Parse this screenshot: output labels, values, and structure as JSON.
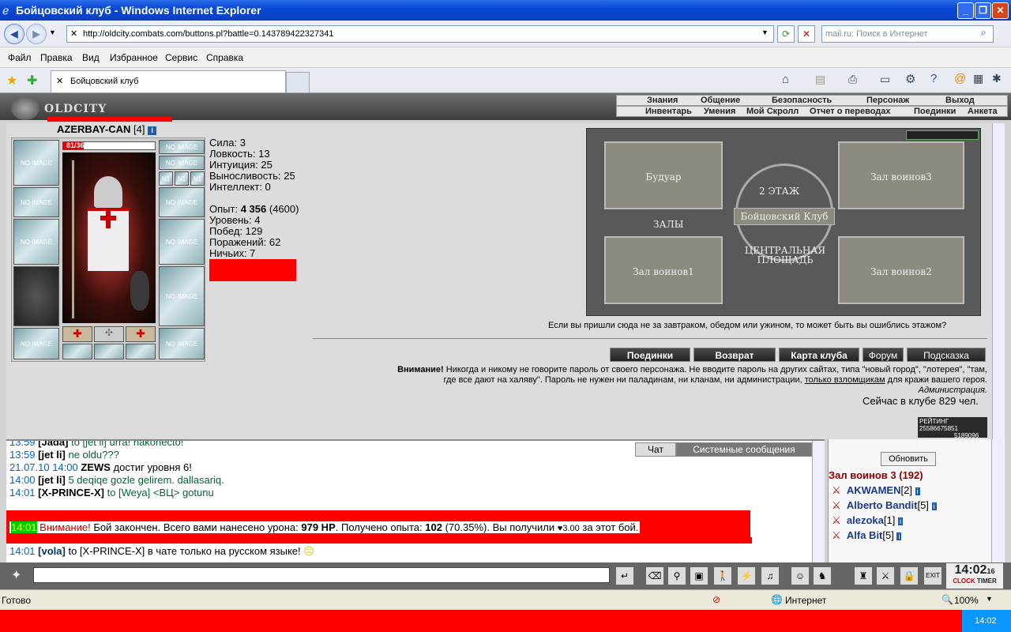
{
  "window": {
    "title": "Бойцовский клуб - Windows Internet Explorer"
  },
  "address": {
    "url": "http://oldcity.combats.com/buttons.pl?battle=0.143789422327341",
    "search_placeholder": "mail.ru: Поиск в Интернет"
  },
  "menu": [
    "Файл",
    "Правка",
    "Вид",
    "Избранное",
    "Сервис",
    "Справка"
  ],
  "tab": {
    "title": "Бойцовский клуб"
  },
  "game": {
    "logo": "OLDCITY",
    "menu_top": [
      "Знания",
      "Общение",
      "Безопасность",
      "Персонаж",
      "Выход"
    ],
    "menu_bottom": [
      "Инвентарь",
      "Умения",
      "Мой Скролл",
      "Отчет о переводах",
      "Поединки",
      "Анкета"
    ],
    "character": {
      "name": "AZERBAY-CAN",
      "level": "[4]",
      "hp_text": "81/364",
      "hp_fraction": 0.22,
      "no_image": "NO IMAGE",
      "n1": "N1"
    },
    "stats": {
      "str": "Сила: 3",
      "agi": "Ловкость: 13",
      "int": "Интуиция: 25",
      "end": "Выносливость: 25",
      "intel": "Интеллект: 0",
      "exp_label": "Опыт:",
      "exp_value": "4 356",
      "exp_next": "(4600)",
      "level": "Уровень: 4",
      "wins": "Побед: 129",
      "losses": "Поражений: 62",
      "draws": "Ничьих: 7"
    },
    "map": {
      "floor": "2 ЭТАЖ",
      "club": "Бойцовский Клуб",
      "halls": "ЗАЛЫ",
      "square": "ЦЕНТРАЛЬНАЯ ПЛОЩАДЬ",
      "boudoir": "Будуар",
      "hall3": "Зал воинов3",
      "hall1": "Зал воинов1",
      "hall2": "Зал воинов2"
    },
    "note": "Если вы пришли сюда не за завтраком, обедом или ужином, то может быть вы ошиблись этажом?",
    "buttons": [
      "Поединки",
      "Возврат",
      "Карта клуба",
      "Форум",
      "Подсказка"
    ],
    "warning_title": "Внимание!",
    "warning_text1": "Никогда и никому не говорите пароль от своего персонажа. Не вводите пароль на других сайтах, типа \"новый город\", \"лотерея\", \"там,",
    "warning_text2a": "где все дают на халяву\". Пароль не нужен ни паладинам, ни кланам, ни администрации,",
    "warning_link": "только взломщикам",
    "warning_text2b": "для кражи вашего героя.",
    "admin": "Администрация.",
    "online": "Сейчас в клубе 829 чел.",
    "rating": "РЕЙТИНГ",
    "rating_num": "25586675851",
    "rating_num2": "5189096"
  },
  "chat": {
    "tabs": [
      "Чат",
      "Системные сообщения"
    ],
    "lines": [
      {
        "time": "13:59",
        "nick": "[Jada]",
        "text": "to [jet li] urra! nakonecto!"
      },
      {
        "time": "13:59",
        "nick": "[jet li]",
        "text": "ne oldu???"
      },
      {
        "time": "21.07.10 14:00",
        "nick": "ZEWS",
        "text": "достиг уровня 6!"
      },
      {
        "time": "14:00",
        "nick": "[jet li]",
        "text": "5 deqiqe gozle gelirem. dallasariq."
      },
      {
        "time": "14:01",
        "nick": "[X-PRINCE-X]",
        "text": "to [Weya] <ВЦ> gotunu"
      }
    ],
    "battle": {
      "time": "14:01",
      "label": "Внимание!",
      "text1": "Бой закончен. Всего вами нанесено урона:",
      "dmg": "979 HP",
      "text2": ". Получено опыта:",
      "exp": "102",
      "text3": "(70.35%). Вы получили",
      "money": "♥3.00",
      "text4": "за этот бой."
    },
    "last": {
      "time": "14:01",
      "nick": "[vola]",
      "text": "to [X-PRINCE-X] в чате только на русском языке!"
    }
  },
  "side": {
    "refresh": "Обновить",
    "room": "Зал воинов 3 (192)",
    "users": [
      {
        "name": "AKWAMEN",
        "lvl": "[2]"
      },
      {
        "name": "Alberto Bandit",
        "lvl": "[5]"
      },
      {
        "name": "alezoka",
        "lvl": "[1]"
      },
      {
        "name": "Alfa Bit",
        "lvl": "[5]"
      }
    ]
  },
  "clock": {
    "time": "14:02",
    "sec": "16",
    "label1": "CLOCK",
    "label2": "TIMER"
  },
  "status": {
    "ready": "Готово",
    "zone": "Интернет",
    "zoom": "100%"
  },
  "tray": {
    "time": "14:02"
  }
}
